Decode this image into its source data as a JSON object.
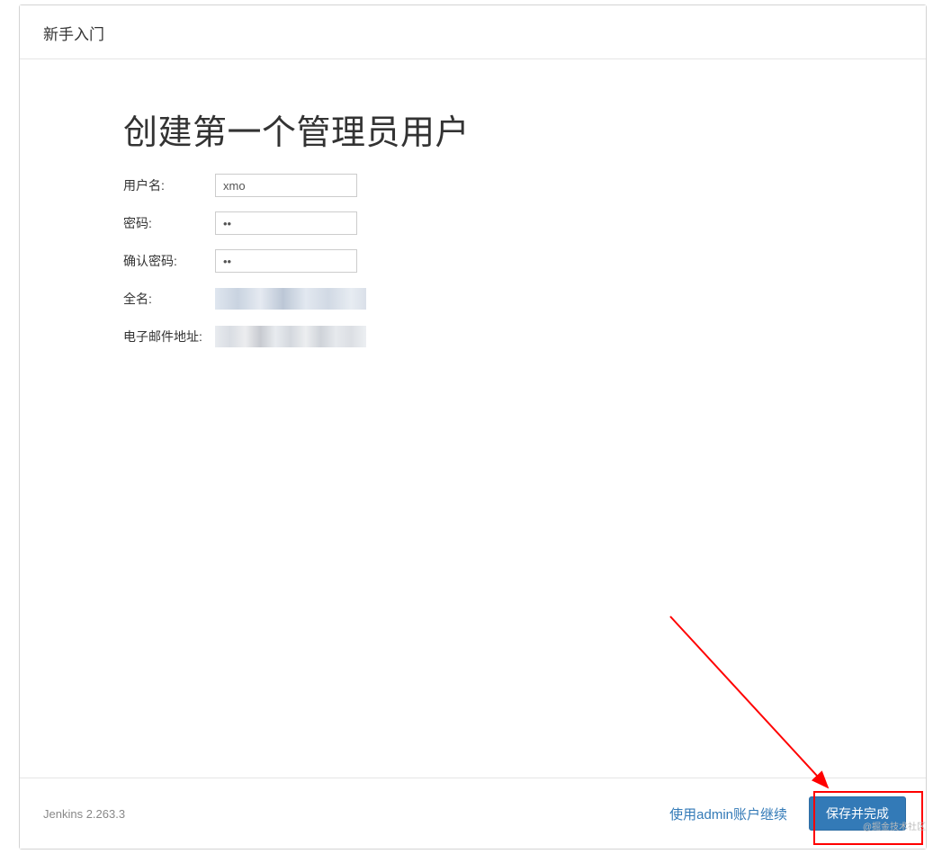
{
  "header": {
    "title": "新手入门"
  },
  "main": {
    "heading": "创建第一个管理员用户",
    "form": {
      "username": {
        "label": "用户名:",
        "value": "xmo"
      },
      "password": {
        "label": "密码:",
        "value": "••"
      },
      "confirm_password": {
        "label": "确认密码:",
        "value": "••"
      },
      "fullname": {
        "label": "全名:"
      },
      "email": {
        "label": "电子邮件地址:"
      }
    }
  },
  "footer": {
    "version": "Jenkins 2.263.3",
    "continue_as_admin": "使用admin账户继续",
    "save_and_finish": "保存并完成"
  },
  "watermark": "@掘金技术社区"
}
